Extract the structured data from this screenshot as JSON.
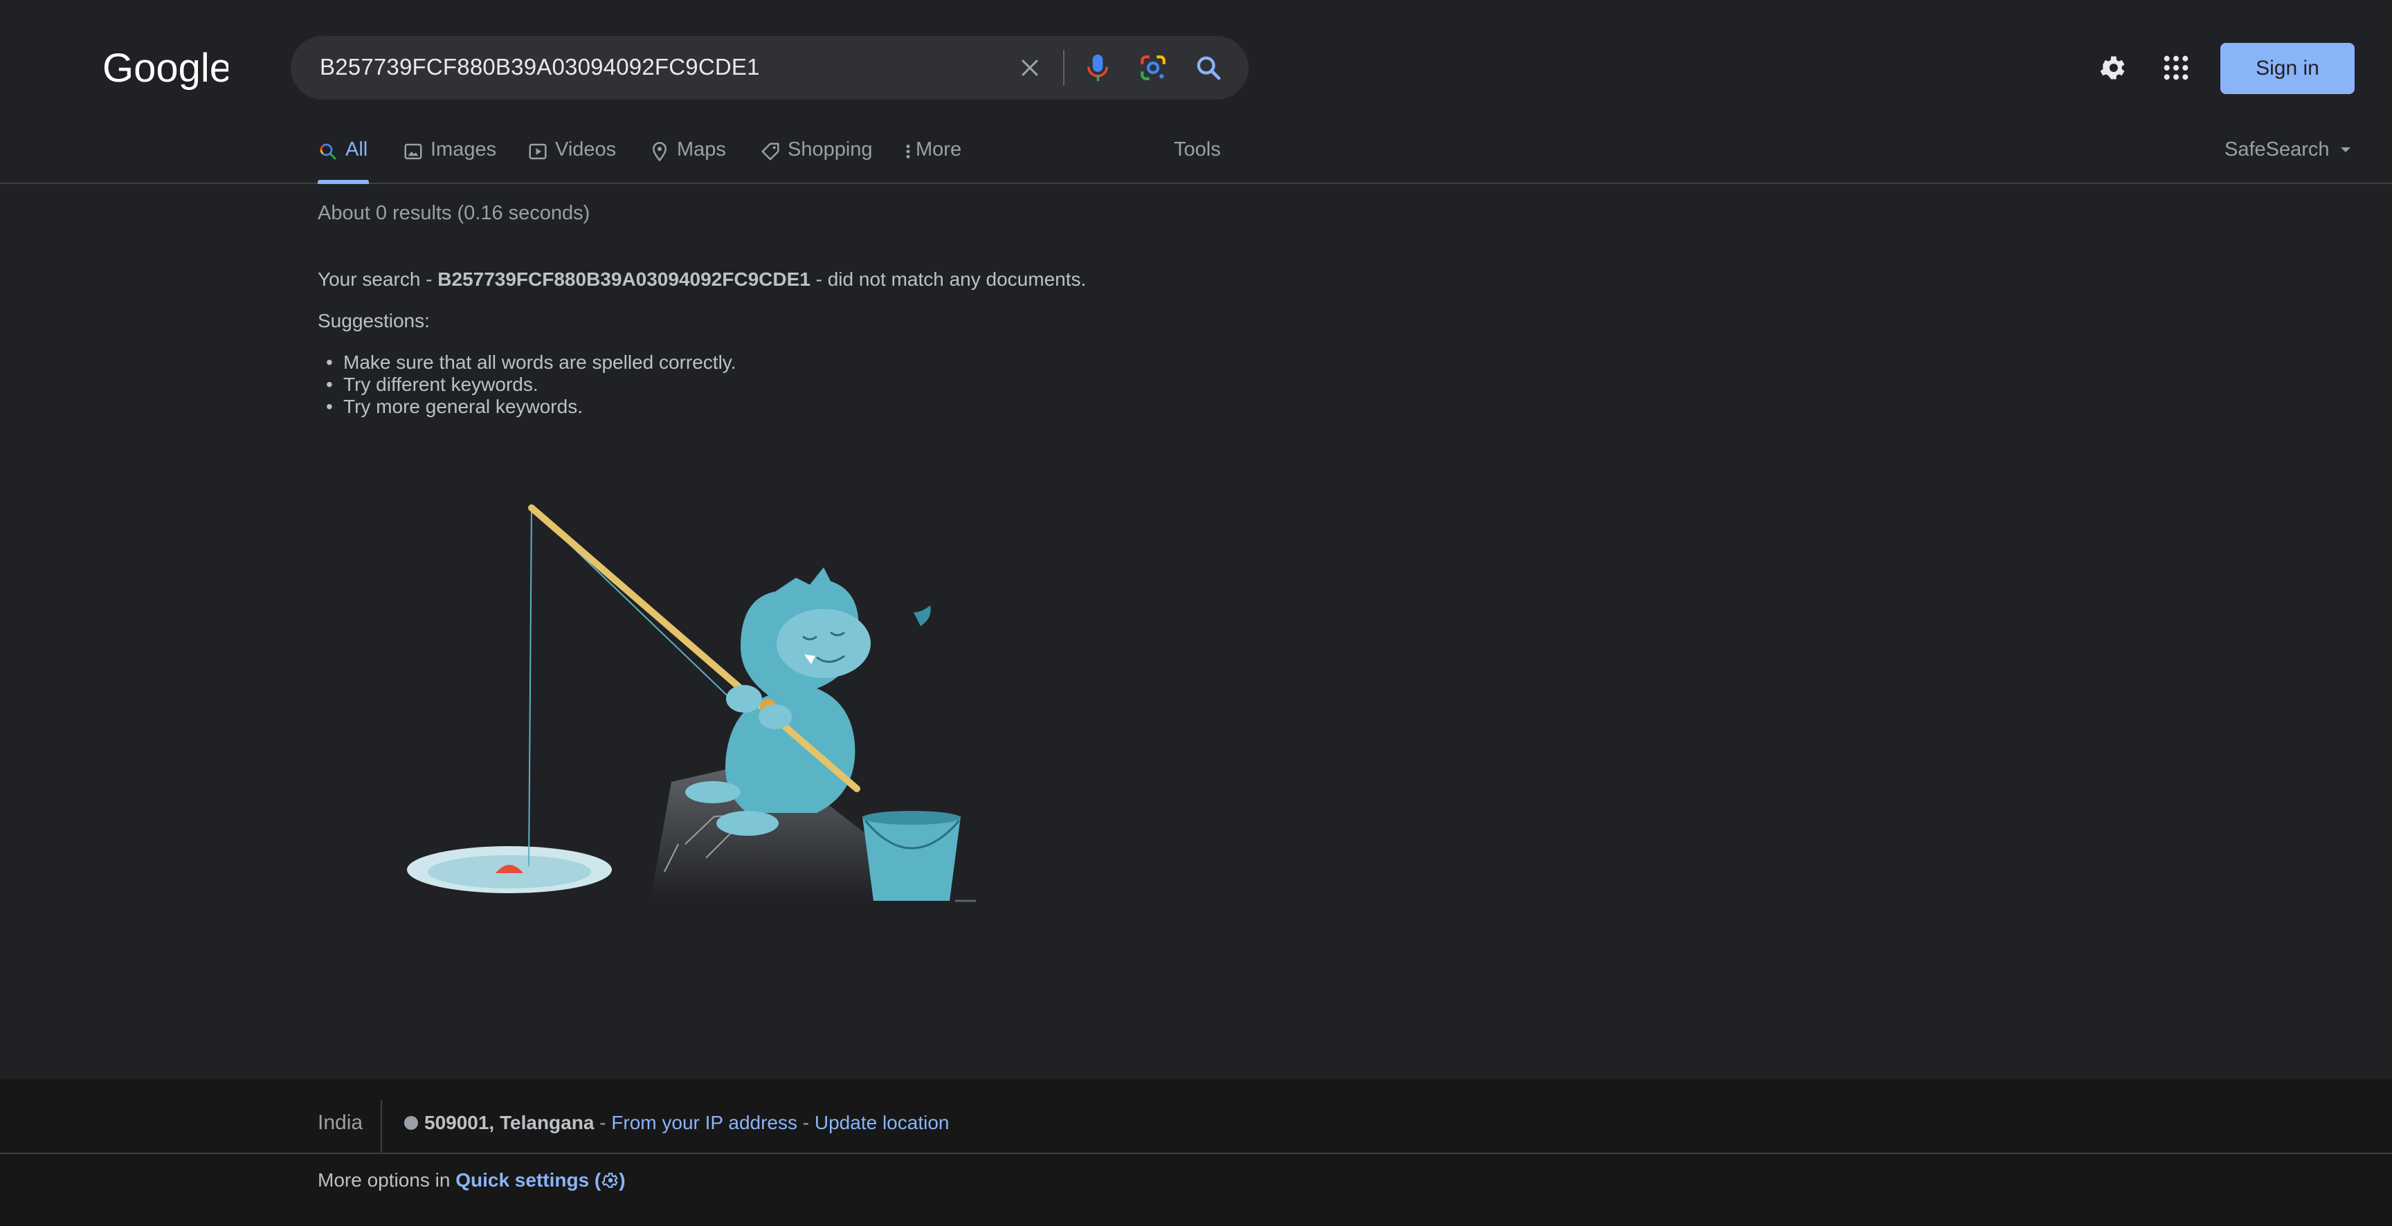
{
  "header": {
    "logo_text": "Google",
    "search_query": "B257739FCF880B39A03094092FC9CDE1",
    "signin_label": "Sign in"
  },
  "tabs": [
    {
      "label": "All",
      "icon": "search-icon",
      "active": true
    },
    {
      "label": "Images",
      "icon": "image-icon"
    },
    {
      "label": "Videos",
      "icon": "play-icon"
    },
    {
      "label": "Maps",
      "icon": "map-pin-icon"
    },
    {
      "label": "Shopping",
      "icon": "tag-icon"
    },
    {
      "label": "More",
      "icon": "more-vert-icon"
    }
  ],
  "tools_label": "Tools",
  "safesearch_label": "SafeSearch",
  "results": {
    "stats": "About 0 results (0.16 seconds)",
    "no_match_prefix": "Your search - ",
    "no_match_query": "B257739FCF880B39A03094092FC9CDE1",
    "no_match_suffix": " - did not match any documents.",
    "suggestions_title": "Suggestions:",
    "suggestions": [
      "Make sure that all words are spelled correctly.",
      "Try different keywords.",
      "Try more general keywords."
    ]
  },
  "footer": {
    "country": "India",
    "location": "509001, Telangana",
    "sep1": " - ",
    "ip_link": "From your IP address",
    "sep2": " - ",
    "update_link": "Update location",
    "more_options_prefix": "More options in ",
    "quick_settings_link": "Quick settings (",
    "quick_settings_close": ")"
  },
  "colors": {
    "background": "#202124",
    "footer_bg": "#171717",
    "accent": "#8ab4f8",
    "text": "#bdc1c6",
    "muted": "#9aa0a6"
  }
}
